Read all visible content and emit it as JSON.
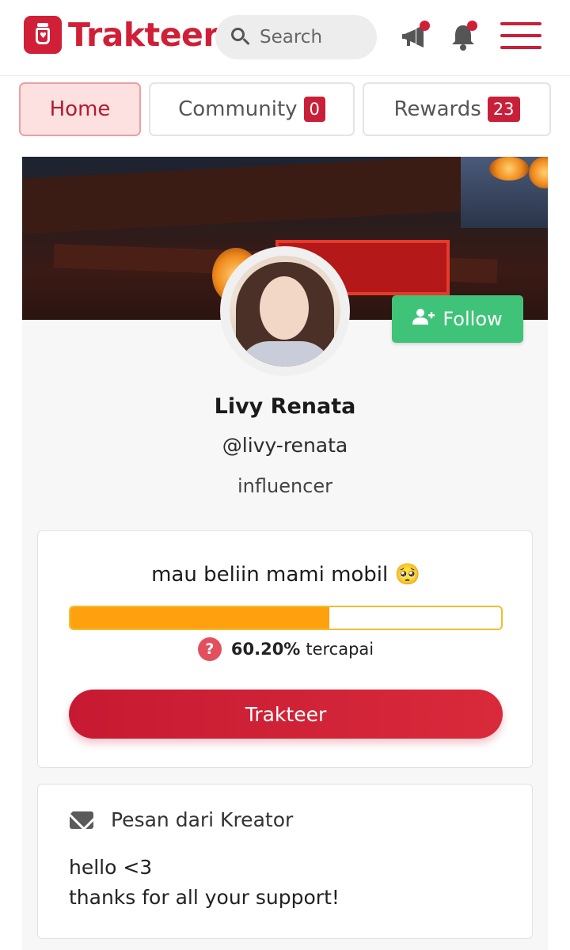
{
  "header": {
    "logo_text": "Trakteer",
    "search_placeholder": "Search",
    "brand_color": "#d01f36"
  },
  "tabs": [
    {
      "label": "Home",
      "active": true
    },
    {
      "label": "Community",
      "badge": "0"
    },
    {
      "label": "Rewards",
      "badge": "23"
    }
  ],
  "profile": {
    "follow_label": "Follow",
    "name": "Livy Renata",
    "handle": "@livy-renata",
    "role": "influencer"
  },
  "goal": {
    "title": "mau beliin mami mobil 🥺",
    "progress_percent": 60.2,
    "percent_text": "60.20%",
    "percent_suffix": "tercapai",
    "button_label": "Trakteer"
  },
  "message": {
    "heading": "Pesan dari Kreator",
    "line1": "hello <3",
    "line2": "thanks for all your support!"
  }
}
